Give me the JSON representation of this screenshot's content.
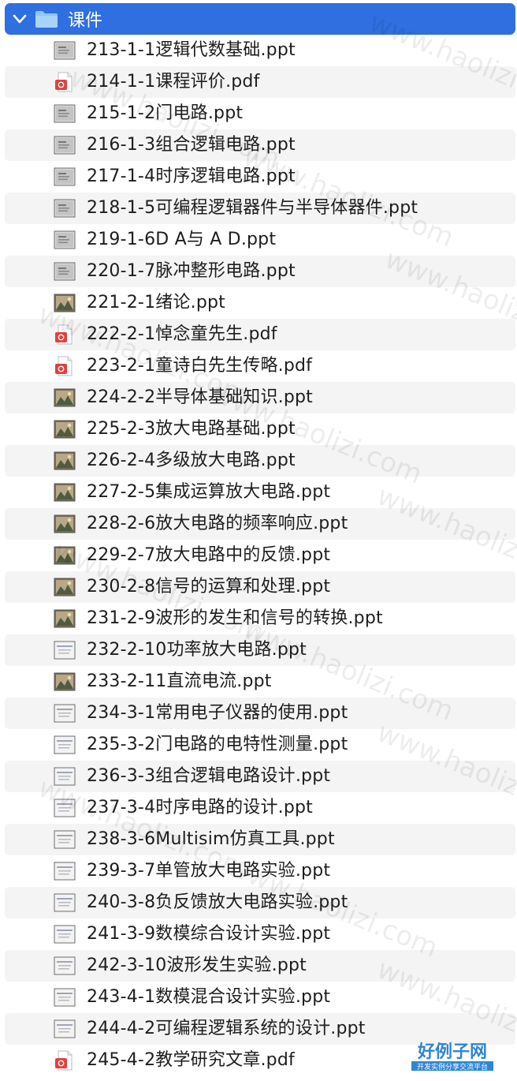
{
  "folder": {
    "label": "课件"
  },
  "files": [
    {
      "name": "213-1-1逻辑代数基础.ppt",
      "icon": "ppt-slide-icon"
    },
    {
      "name": "214-1-1课程评价.pdf",
      "icon": "pdf-icon"
    },
    {
      "name": "215-1-2门电路.ppt",
      "icon": "ppt-slide-icon"
    },
    {
      "name": "216-1-3组合逻辑电路.ppt",
      "icon": "ppt-slide-icon"
    },
    {
      "name": "217-1-4时序逻辑电路.ppt",
      "icon": "ppt-slide-icon"
    },
    {
      "name": "218-1-5可编程逻辑器件与半导体器件.ppt",
      "icon": "ppt-slide-icon"
    },
    {
      "name": "219-1-6D A与 A D.ppt",
      "icon": "ppt-slide-icon"
    },
    {
      "name": "220-1-7脉冲整形电路.ppt",
      "icon": "ppt-slide-icon"
    },
    {
      "name": "221-2-1绪论.ppt",
      "icon": "ppt-photo-icon"
    },
    {
      "name": "222-2-1悼念童先生.pdf",
      "icon": "pdf-icon"
    },
    {
      "name": "223-2-1童诗白先生传略.pdf",
      "icon": "pdf-icon"
    },
    {
      "name": "224-2-2半导体基础知识.ppt",
      "icon": "ppt-photo-icon"
    },
    {
      "name": "225-2-3放大电路基础.ppt",
      "icon": "ppt-photo-icon"
    },
    {
      "name": "226-2-4多级放大电路.ppt",
      "icon": "ppt-photo-icon"
    },
    {
      "name": "227-2-5集成运算放大电路.ppt",
      "icon": "ppt-photo-icon"
    },
    {
      "name": "228-2-6放大电路的频率响应.ppt",
      "icon": "ppt-photo-icon"
    },
    {
      "name": "229-2-7放大电路中的反馈.ppt",
      "icon": "ppt-photo-icon"
    },
    {
      "name": "230-2-8信号的运算和处理.ppt",
      "icon": "ppt-photo-icon"
    },
    {
      "name": "231-2-9波形的发生和信号的转换.ppt",
      "icon": "ppt-photo-icon"
    },
    {
      "name": "232-2-10功率放大电路.ppt",
      "icon": "ppt-light-icon"
    },
    {
      "name": "233-2-11直流电流.ppt",
      "icon": "ppt-photo-icon"
    },
    {
      "name": "234-3-1常用电子仪器的使用.ppt",
      "icon": "ppt-light-icon"
    },
    {
      "name": "235-3-2门电路的电特性测量.ppt",
      "icon": "ppt-light-icon"
    },
    {
      "name": "236-3-3组合逻辑电路设计.ppt",
      "icon": "ppt-light-icon"
    },
    {
      "name": "237-3-4时序电路的设计.ppt",
      "icon": "ppt-light-icon"
    },
    {
      "name": "238-3-6Multisim仿真工具.ppt",
      "icon": "ppt-light-icon"
    },
    {
      "name": "239-3-7单管放大电路实验.ppt",
      "icon": "ppt-light-icon"
    },
    {
      "name": "240-3-8负反馈放大电路实验.ppt",
      "icon": "ppt-light-icon"
    },
    {
      "name": "241-3-9数模综合设计实验.ppt",
      "icon": "ppt-light-icon"
    },
    {
      "name": "242-3-10波形发生实验.ppt",
      "icon": "ppt-light-icon"
    },
    {
      "name": "243-4-1数模混合设计实验.ppt",
      "icon": "ppt-light-icon"
    },
    {
      "name": "244-4-2可编程逻辑系统的设计.ppt",
      "icon": "ppt-light-icon"
    },
    {
      "name": "245-4-2教学研究文章.pdf",
      "icon": "pdf-icon"
    }
  ],
  "watermark": "www.haolizi.com",
  "logo": {
    "title": "好例子网",
    "subtitle": "开发实例分享交流平台"
  },
  "colors": {
    "selection": "#2f6fe0",
    "folder": "#8ec5f6",
    "pdf": "#e0413d",
    "stripe": "#f4f4f4"
  }
}
